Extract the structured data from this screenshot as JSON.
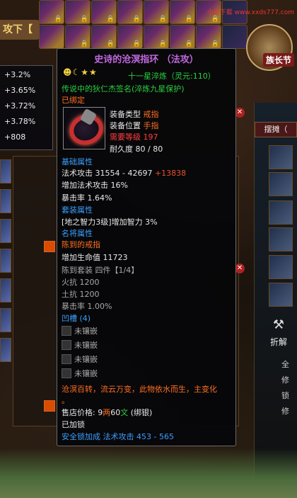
{
  "watermark": "小皮下载 www.xxds777.com",
  "left_tab_label": "攻下【",
  "clan_badge_label": "族长节",
  "stats_popup": [
    "+3.2%",
    "+3.65%",
    "+3.72%",
    "+3.78%",
    "+808"
  ],
  "stall_button": "摆摊（",
  "decompose_label": "折解",
  "right_dots": [
    "全",
    "修",
    "锁",
    "修"
  ],
  "tooltip": {
    "title": "史诗的沧溟指环 （法攻）",
    "grade_icons": "☻☾★★",
    "refine_text": "十一星淬炼（灵元:110）",
    "legend_line": "传说中的狄仁杰签名(淬炼九星保护)",
    "bound": "已绑定",
    "equip_type_label": "装备类型",
    "equip_type_value": "戒指",
    "equip_slot_label": "装备位置",
    "equip_slot_value": "手指",
    "required_level_label": "需要等级",
    "required_level_value": "197",
    "durability_label": "耐久度",
    "durability_value": "80 / 80",
    "base_attr_header": "基础属性",
    "magic_attack_label": "法术攻击",
    "magic_attack_value": "31554 - 42697",
    "magic_attack_bonus": "+13838",
    "magic_attack_pct": "增加法术攻击 16%",
    "crit_rate": "暴击率  1.64%",
    "set_attr_header": "套装属性",
    "set_attr_line": "[地之智力3级]增加智力 3%",
    "general_attr_header": "名将属性",
    "jenhung_header": "陈到的戒指",
    "hp_bonus": "增加生命值 11723",
    "set_label": "陈到套装 四件【1/4】",
    "fire_res": "火抗 1200",
    "earth_res": "土抗 1200",
    "crit_rate2": "暴击率 1.00%",
    "socket_header": "凹槽 (4)",
    "sockets": [
      "未镶嵌",
      "未镶嵌",
      "未镶嵌",
      "未镶嵌"
    ],
    "flavor_1": "沧溟百转，流云万变，此物依水而生，主变化",
    "flavor_2": "。",
    "price_label": "售店价格:",
    "price_liang": "9",
    "price_liang_unit": "两",
    "price_wen": "60",
    "price_wen_unit": "文",
    "price_note": "(绑银)",
    "locked": "已加锁",
    "safe_lock_bonus": "安全锁加成   法术攻击 453 - 565"
  }
}
